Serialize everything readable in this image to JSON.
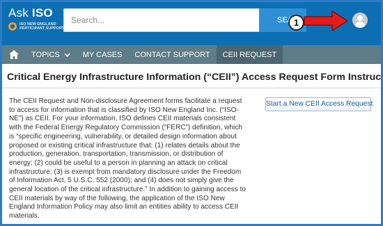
{
  "header": {
    "logo_word_ask": "Ask",
    "logo_word_iso": "ISO",
    "logo_sub_line1": "ISO NEW ENGLAND",
    "logo_sub_line2": "PARTICIPANT SUPPORT",
    "search_placeholder": "Search...",
    "search_button_label": "SEARCH",
    "callout_number": "1"
  },
  "nav": {
    "items": [
      {
        "label": "TOPICS"
      },
      {
        "label": "MY CASES"
      },
      {
        "label": "CONTACT SUPPORT"
      },
      {
        "label": "CEII REQUEST"
      }
    ],
    "active_index": 3
  },
  "page": {
    "title": "Critical Energy Infrastructure Information (“CEII”) Access Request Form Instructions",
    "start_button_label": "Start a New CEII Access Request",
    "body": "The CEII Request and Non-disclosure Agreement forms facilitate a request to access for information that is classified by ISO New England Inc. (“ISO-NE”) as CEII. For your information, ISO defines CEII materials consistent with the Federal Energy Regulatory Commission (“FERC”) definition, which is “specific engineering, vulnerability, or detailed design information about proposed or existing critical infrastructure that: (1) relates details about the production, generation, transportation, transmission, or distribution of energy; (2) could be useful to a person in planning an attack on critical infrastructure; (3) is exempt from mandatory disclosure under the Freedom of Information Act, 5 U.S.C. 552 (2000); and (4) does not simply give the general location of the critical infrastructure.” In addition to gaining access to CEII materials by way of the following, the application of the ISO New England Information Policy may also limit an entities ability to access CEII materials."
  },
  "colors": {
    "header_bg": "#0d6fb3",
    "nav_bg": "#5e7d88",
    "nav_active_bg": "#4b6670",
    "callout_arrow": "#e31b1b",
    "frame_border": "#2e7cc6"
  }
}
